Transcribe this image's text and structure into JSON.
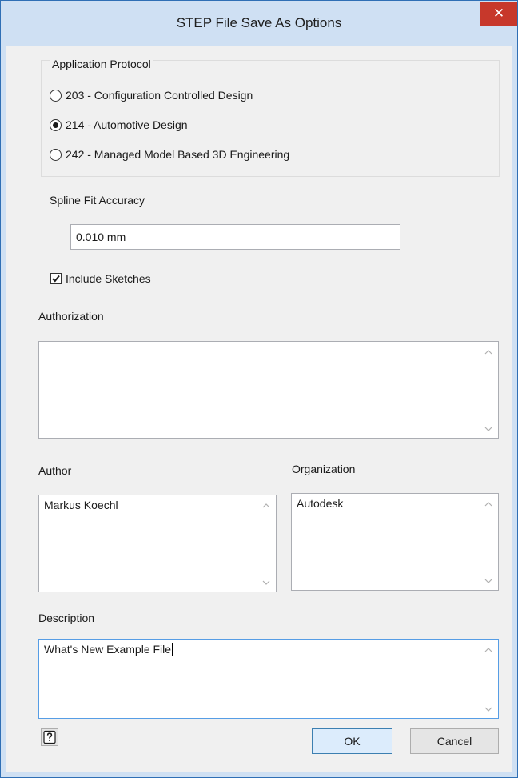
{
  "window": {
    "title": "STEP File Save As Options",
    "close_glyph": "✕"
  },
  "protocol": {
    "legend": "Application Protocol",
    "options": [
      {
        "label": "203 - Configuration Controlled Design",
        "checked": false
      },
      {
        "label": "214 - Automotive Design",
        "checked": true
      },
      {
        "label": "242 - Managed Model Based 3D Engineering",
        "checked": false
      }
    ]
  },
  "spline": {
    "label": "Spline Fit Accuracy",
    "value": "0.010 mm"
  },
  "sketches": {
    "label": "Include Sketches",
    "checked": true
  },
  "authorization": {
    "label": "Authorization",
    "value": ""
  },
  "author": {
    "label": "Author",
    "value": "Markus Koechl"
  },
  "organization": {
    "label": "Organization",
    "value": "Autodesk"
  },
  "description": {
    "label": "Description",
    "value": "What's New Example File"
  },
  "buttons": {
    "ok": "OK",
    "cancel": "Cancel"
  },
  "colors": {
    "accent": "#2f6fb5",
    "close": "#c7382b",
    "focus_border": "#569de5"
  }
}
